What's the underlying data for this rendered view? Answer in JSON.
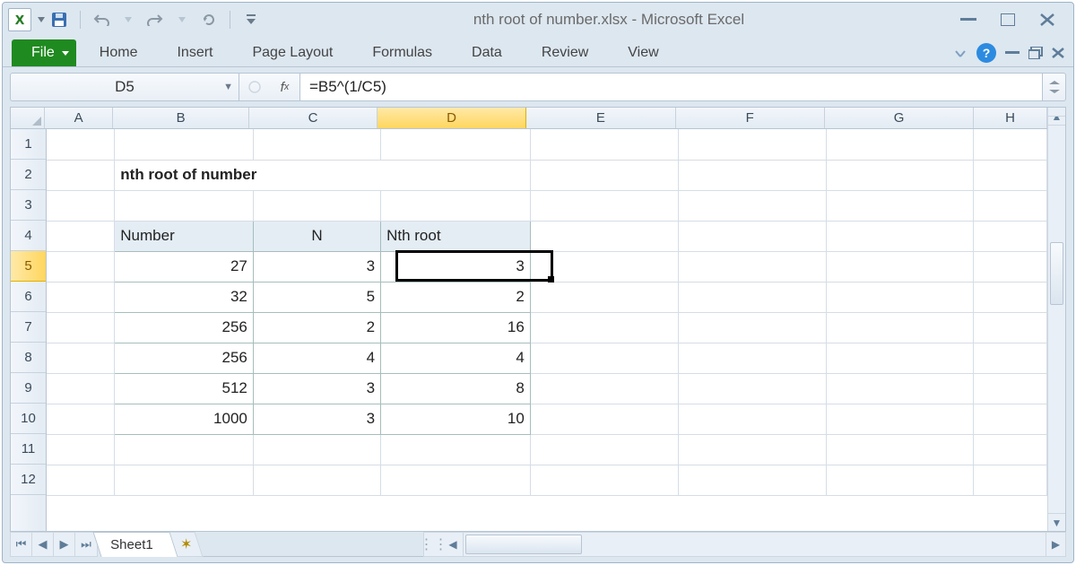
{
  "window": {
    "title": "nth root of number.xlsx  -  Microsoft Excel",
    "app_logo_letter": "X"
  },
  "qat": {
    "save": "save-icon",
    "undo": "undo-icon",
    "redo": "redo-icon",
    "refresh": "refresh-icon"
  },
  "ribbon": {
    "file": "File",
    "tabs": [
      "Home",
      "Insert",
      "Page Layout",
      "Formulas",
      "Data",
      "Review",
      "View"
    ]
  },
  "namebox": {
    "value": "D5"
  },
  "formula_bar": {
    "value": "=B5^(1/C5)"
  },
  "columns": {
    "labels": [
      "A",
      "B",
      "C",
      "D",
      "E",
      "F",
      "G",
      "H"
    ],
    "widths": [
      80,
      160,
      150,
      175,
      175,
      175,
      175,
      86
    ],
    "active_index": 3
  },
  "rows": {
    "count": 12,
    "height": 34,
    "active_index": 5
  },
  "sheet": {
    "title_text": "nth root of number",
    "title_cell": "B2",
    "table": {
      "range": "B4:D10",
      "headers": [
        "Number",
        "N",
        "Nth root"
      ],
      "data": [
        [
          27,
          3,
          3
        ],
        [
          32,
          5,
          2
        ],
        [
          256,
          2,
          16
        ],
        [
          256,
          4,
          4
        ],
        [
          512,
          3,
          8
        ],
        [
          1000,
          3,
          10
        ]
      ]
    },
    "active_cell": "D5"
  },
  "tabs": {
    "active": "Sheet1"
  }
}
